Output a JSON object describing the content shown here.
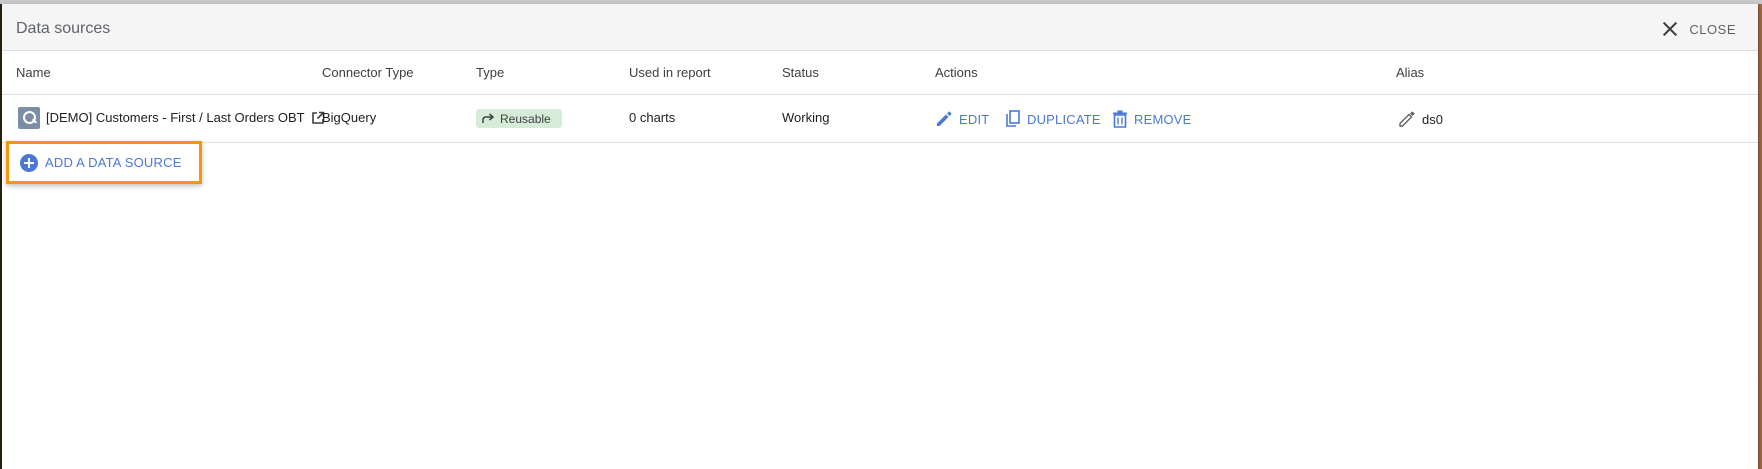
{
  "panel": {
    "title": "Data sources",
    "close_label": "CLOSE"
  },
  "table": {
    "headers": {
      "name": "Name",
      "connector_type": "Connector Type",
      "type": "Type",
      "used_in_report": "Used in report",
      "status": "Status",
      "actions": "Actions",
      "alias": "Alias"
    },
    "rows": [
      {
        "name": "[DEMO] Customers - First / Last Orders OBT",
        "connector_type": "BigQuery",
        "type": "Reusable",
        "used_in_report": "0 charts",
        "status": "Working",
        "actions": {
          "edit": "EDIT",
          "duplicate": "DUPLICATE",
          "remove": "REMOVE"
        },
        "alias": "ds0"
      }
    ]
  },
  "add_button": {
    "label": "ADD A DATA SOURCE"
  },
  "colors": {
    "accent": "#4a78d6",
    "highlight": "#f5950f",
    "badge_bg": "#d6ecd9",
    "icon_gray": "#7a8fa6"
  },
  "icons": {
    "close": "close-icon",
    "data_source": "data-source-icon",
    "external_link": "external-link-icon",
    "reusable": "share-arrow-icon",
    "edit": "pencil-icon",
    "duplicate": "copy-icon",
    "remove": "trash-icon",
    "alias_edit": "pencil-icon",
    "add": "plus-circle-icon"
  }
}
